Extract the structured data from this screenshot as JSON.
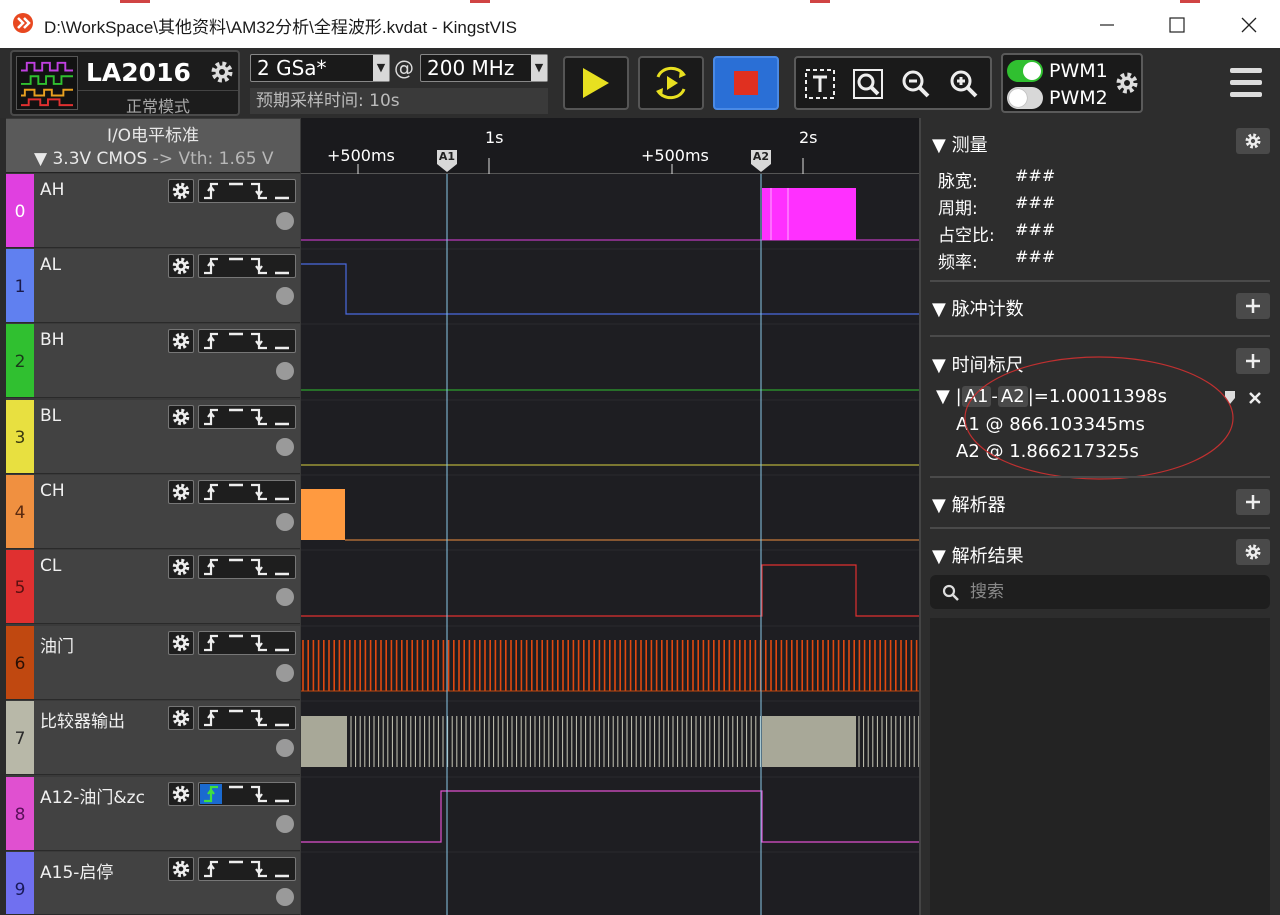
{
  "window": {
    "title": "D:\\WorkSpace\\其他资料\\AM32分析\\全程波形.kvdat - KingstVIS",
    "minimize": "—",
    "maximize": "☐",
    "close": "✕"
  },
  "device": {
    "name": "LA2016",
    "mode": "正常模式",
    "sample_rate": "2 GSa*",
    "at": "@",
    "sample_freq": "200 MHz",
    "expected_time": "预期采样时间: 10s"
  },
  "pwm": {
    "pwm1": "PWM1",
    "pwm2": "PWM2",
    "pwm1_on": true,
    "pwm2_on": false
  },
  "io_standard": {
    "title": "I/O电平标准",
    "level": "▼ 3.3V CMOS",
    "vth": " -> Vth: 1.65 V"
  },
  "channels": [
    {
      "num": "0",
      "name": "AH",
      "color": "#e040e0",
      "num_color": "#ffffff"
    },
    {
      "num": "1",
      "name": "AL",
      "color": "#6080f0",
      "num_color": "#1a1a4a"
    },
    {
      "num": "2",
      "name": "BH",
      "color": "#30c030",
      "num_color": "#1a3a1a"
    },
    {
      "num": "3",
      "name": "BL",
      "color": "#e8e040",
      "num_color": "#3a3a10"
    },
    {
      "num": "4",
      "name": "CH",
      "color": "#f09040",
      "num_color": "#5a2a10"
    },
    {
      "num": "5",
      "name": "CL",
      "color": "#e03030",
      "num_color": "#5a1010"
    },
    {
      "num": "6",
      "name": "油门",
      "color": "#c04810",
      "num_color": "#2a1005"
    },
    {
      "num": "7",
      "name": "比较器输出",
      "color": "#b8b8a8",
      "num_color": "#2a2a2a"
    },
    {
      "num": "8",
      "name": "A12-油门&zc",
      "color": "#e050d0",
      "num_color": "#5a105a"
    },
    {
      "num": "9",
      "name": "A15-启停",
      "color": "#7070f0",
      "num_color": "#1a1a5a"
    }
  ],
  "timeline": {
    "labels": [
      "+500ms",
      "1s",
      "+500ms",
      "2s"
    ],
    "marker_a1": "A1",
    "marker_a2": "A2"
  },
  "measure": {
    "title": "测量",
    "rows": [
      {
        "label": "脉宽:",
        "value": "###"
      },
      {
        "label": "周期:",
        "value": "###"
      },
      {
        "label": "占空比:",
        "value": "###"
      },
      {
        "label": "频率:",
        "value": "###"
      }
    ]
  },
  "pulse_count": {
    "title": "脉冲计数"
  },
  "time_ruler": {
    "title": "时间标尺",
    "pipe_open": "|",
    "a1": "A1",
    "dash": "-",
    "a2": "A2",
    "result": "|=1.00011398s",
    "a1_line": "A1 @ 866.103345ms",
    "a2_line": "A2 @ 1.866217325s"
  },
  "decoder": {
    "title": "解析器"
  },
  "decode_result": {
    "title": "解析结果",
    "search_placeholder": "搜索"
  },
  "colors": {
    "accent_blue": "#2a6fd6",
    "play_yellow": "#e8e020",
    "stop_red": "#e03020",
    "pwm_green": "#30c030"
  }
}
